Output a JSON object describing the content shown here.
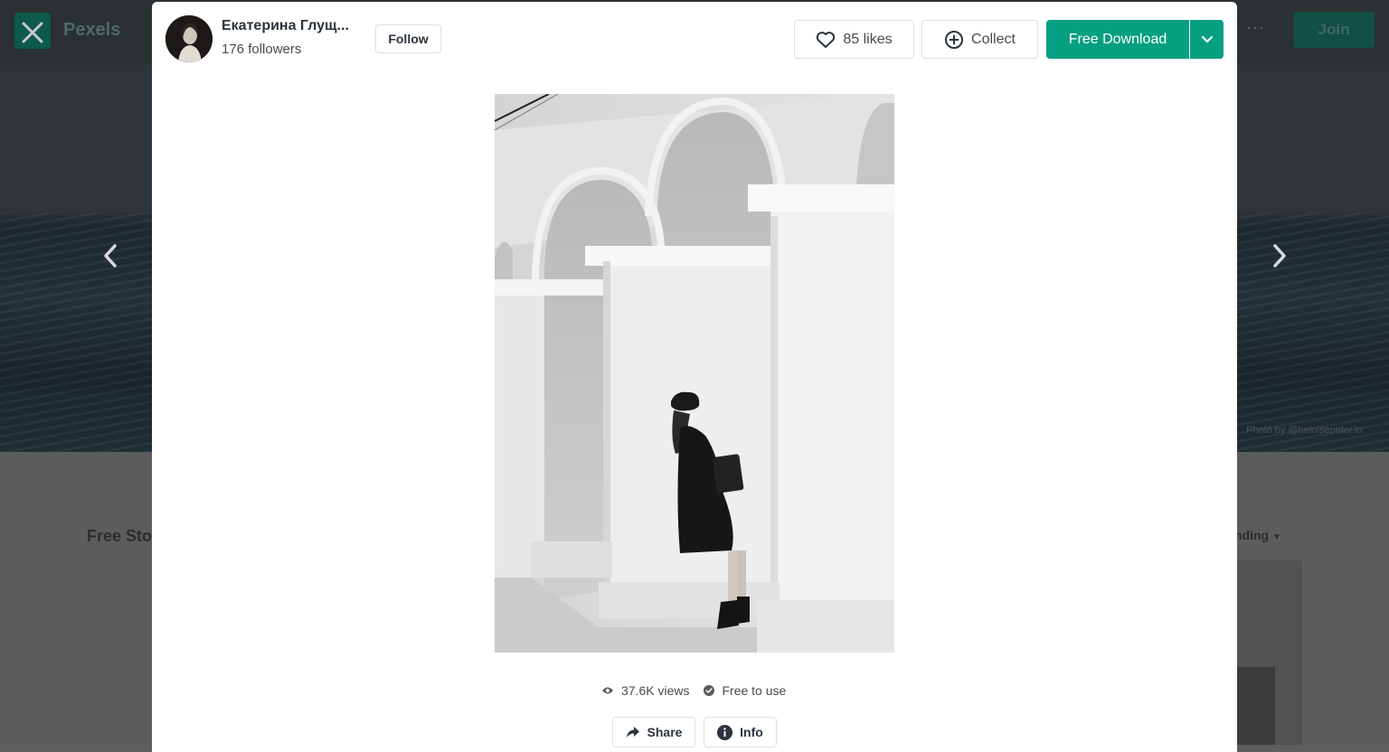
{
  "background": {
    "logo_text": "Pexels",
    "join_label": "Join",
    "more_label": "···",
    "section_title": "Free Sto",
    "sort_label": "nding",
    "photo_credit": "Photo by @heloisepeter.lo"
  },
  "author": {
    "name": "Екатерина Глущ...",
    "followers": "176 followers",
    "follow_label": "Follow"
  },
  "actions": {
    "likes_label": "85 likes",
    "collect_label": "Collect",
    "download_label": "Free Download"
  },
  "stats": {
    "views": "37.6K views",
    "license": "Free to use"
  },
  "footer_buttons": {
    "share_label": "Share",
    "info_label": "Info"
  },
  "colors": {
    "primary": "#05a081",
    "text": "#2c343e",
    "border": "#dfdfe0",
    "overlay": "#5c5c5c"
  },
  "icons": {
    "close": "close-icon",
    "prev": "chevron-left-icon",
    "next": "chevron-right-icon",
    "like": "heart-icon",
    "collect": "plus-circle-icon",
    "download_menu": "chevron-down-icon",
    "views": "eye-icon",
    "license": "check-circle-icon",
    "share": "share-arrow-icon",
    "info": "info-icon"
  }
}
